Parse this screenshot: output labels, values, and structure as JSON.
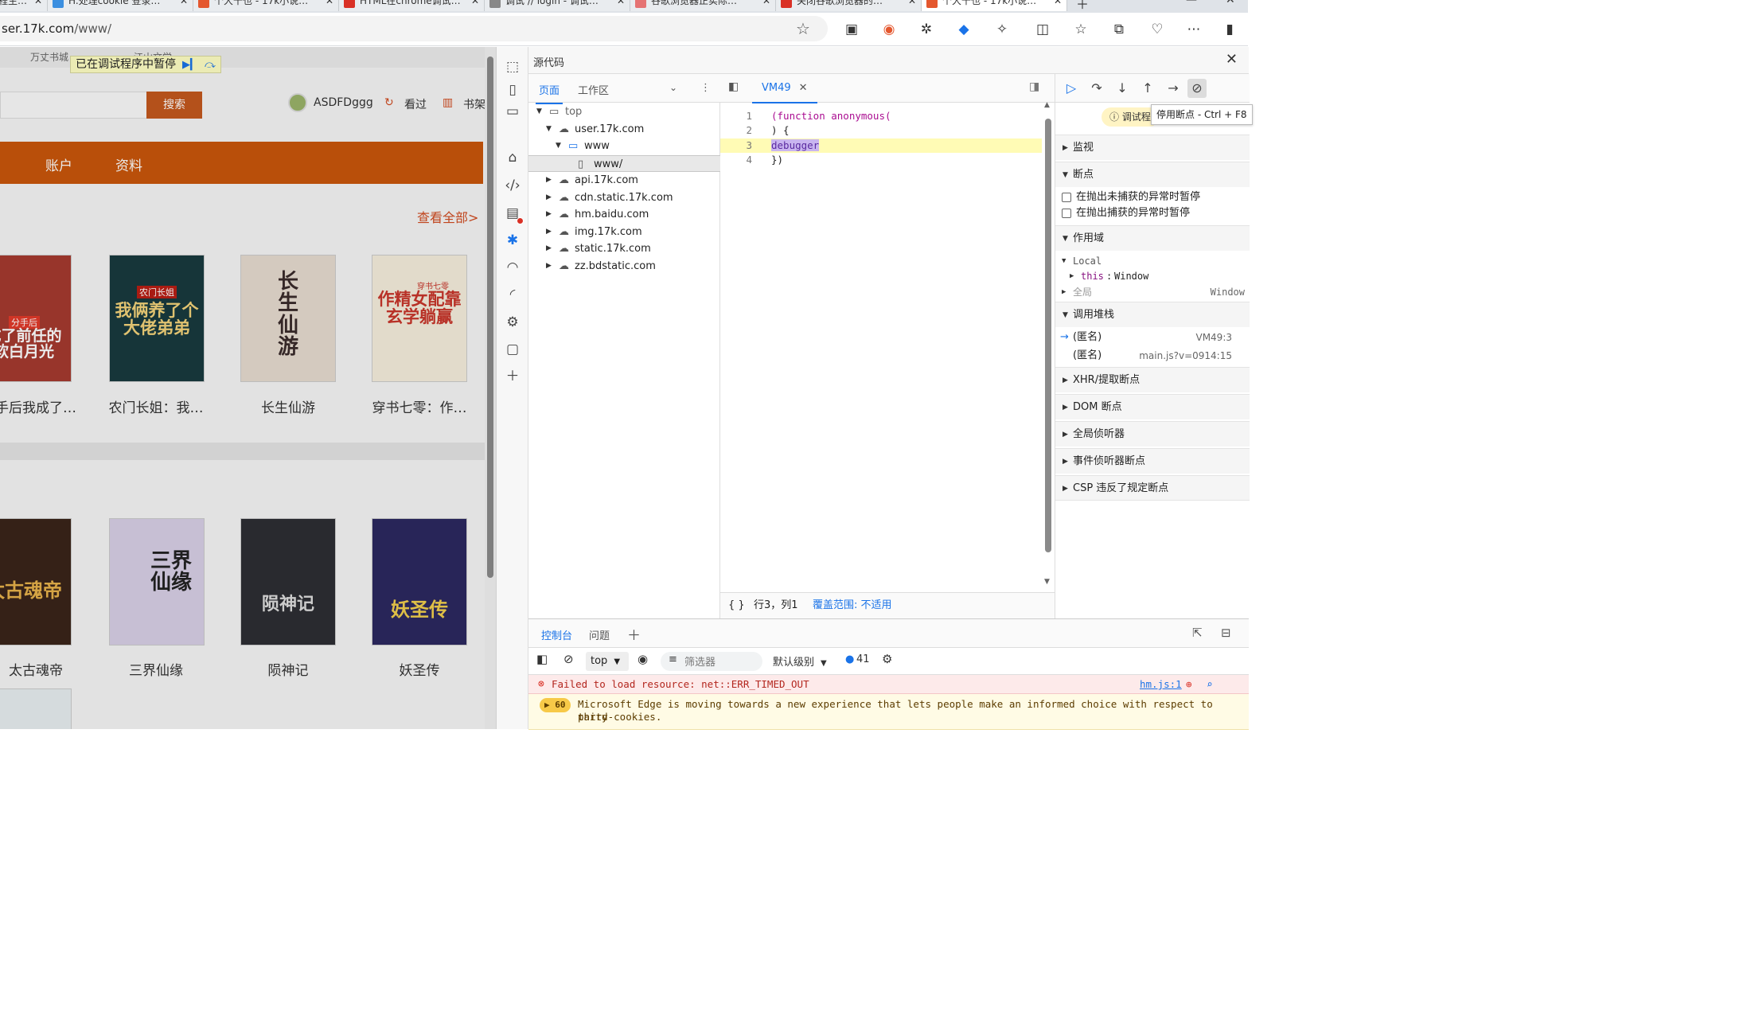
{
  "browser": {
    "tabs": [
      {
        "title": "编程生…"
      },
      {
        "title": "H.处理cookie 登录…"
      },
      {
        "title": "个大千也 - 17k小说…"
      },
      {
        "title": "HTML在chrome调试…"
      },
      {
        "title": "调试 // login - 调试…"
      },
      {
        "title": "谷歌浏览器正实际…"
      },
      {
        "title": "关闭谷歌浏览器的…"
      },
      {
        "title": "个大千也 - 17k小说…"
      }
    ],
    "url_host": "ser.17k.com",
    "url_path": "/www/"
  },
  "page": {
    "top_links": [
      "万丈书城",
      "江山文学"
    ],
    "paused_banner": "已在调试程序中暂停",
    "search_button": "搜索",
    "username": "ASDFDggg",
    "viewed_label": "看过",
    "shelf_label": "书架",
    "nav": [
      "",
      "账户",
      "资料"
    ],
    "view_all": "查看全部>",
    "books_row1": [
      {
        "title": "手后我成了…",
        "cover_text": "成了前任的软白月光",
        "badge": "分手后",
        "cover_color": "#a53a2f"
      },
      {
        "title": "农门长姐：我…",
        "cover_text": "我俩养了个大佬弟弟",
        "badge": "农门长姐",
        "cover_color": "#183a3e"
      },
      {
        "title": "长生仙游",
        "cover_text": "长生仙游",
        "badge": "",
        "cover_color": "#e6dcd0"
      },
      {
        "title": "穿书七零：作…",
        "cover_text": "作精女配靠玄学躺赢",
        "badge": "穿书七零",
        "cover_color": "#f6eedd"
      }
    ],
    "books_row2": [
      {
        "title": "太古魂帝",
        "cover_text": "太古魂帝",
        "cover_color": "#3a241a"
      },
      {
        "title": "三界仙缘",
        "cover_text": "三界仙缘",
        "cover_color": "#d8d0e6"
      },
      {
        "title": "陨神记",
        "cover_text": "陨神记",
        "cover_color": "#2d2e33"
      },
      {
        "title": "妖圣传",
        "cover_text": "妖圣传",
        "cover_color": "#2c2960"
      }
    ]
  },
  "devtools": {
    "panel_title": "源代码",
    "nav_tabs": [
      "页面",
      "工作区"
    ],
    "tree": [
      {
        "label": "top",
        "level": 0,
        "expanded": true,
        "kind": "frame"
      },
      {
        "label": "user.17k.com",
        "level": 1,
        "expanded": true,
        "kind": "cloud"
      },
      {
        "label": "www",
        "level": 2,
        "expanded": true,
        "kind": "folder"
      },
      {
        "label": "www/",
        "level": 3,
        "expanded": false,
        "kind": "file",
        "selected": true
      },
      {
        "label": "api.17k.com",
        "level": 1,
        "expanded": false,
        "kind": "cloud"
      },
      {
        "label": "cdn.static.17k.com",
        "level": 1,
        "expanded": false,
        "kind": "cloud"
      },
      {
        "label": "hm.baidu.com",
        "level": 1,
        "expanded": false,
        "kind": "cloud"
      },
      {
        "label": "img.17k.com",
        "level": 1,
        "expanded": false,
        "kind": "cloud"
      },
      {
        "label": "static.17k.com",
        "level": 1,
        "expanded": false,
        "kind": "cloud"
      },
      {
        "label": "zz.bdstatic.com",
        "level": 1,
        "expanded": false,
        "kind": "cloud"
      }
    ],
    "editor_tab": "VM49",
    "code": [
      {
        "n": "1",
        "text": "(function anonymous("
      },
      {
        "n": "2",
        "text": ") {"
      },
      {
        "n": "3",
        "text": "debugger"
      },
      {
        "n": "4",
        "text": "})"
      }
    ],
    "status_braces": "{ }",
    "status_position": "行3，列1",
    "status_coverage": "覆盖范围: 不适用",
    "paused_pill": "调试程",
    "tooltip": "停用断点 - Ctrl + F8",
    "sections": {
      "watch": "监视",
      "breakpoints": "断点",
      "bp_uncaught": "在抛出未捕获的异常时暂停",
      "bp_caught": "在抛出捕获的异常时暂停",
      "scope": "作用域",
      "scope_local": "Local",
      "scope_this_key": "this",
      "scope_this_val": "Window",
      "scope_global": "全局",
      "scope_global_val": "Window",
      "callstack": "调用堆栈",
      "xhr": "XHR/提取断点",
      "dom": "DOM 断点",
      "global_listeners": "全局侦听器",
      "event_listeners": "事件侦听器断点",
      "csp": "CSP 违反了规定断点"
    },
    "call_stack": [
      {
        "name": "(匿名)",
        "location": "VM49:3",
        "current": true
      },
      {
        "name": "(匿名)",
        "location": "main.js?v=0914:15",
        "current": false
      }
    ],
    "drawer_tabs": [
      "控制台",
      "问题"
    ],
    "console_context": "top",
    "filter_placeholder": "筛选器",
    "level_label": "默认级别",
    "message_count": "41",
    "error_message": "Failed to load resource: net::ERR_TIMED_OUT",
    "error_source": "hm.js:1",
    "warning_count": "60",
    "warning_line1": "Microsoft Edge is moving towards a new experience that lets people make an informed choice with respect to third-",
    "warning_line2": "party cookies."
  },
  "colors": {
    "accent": "#1a73e8",
    "orange": "#c9560b",
    "search_btn": "#c4581e"
  }
}
